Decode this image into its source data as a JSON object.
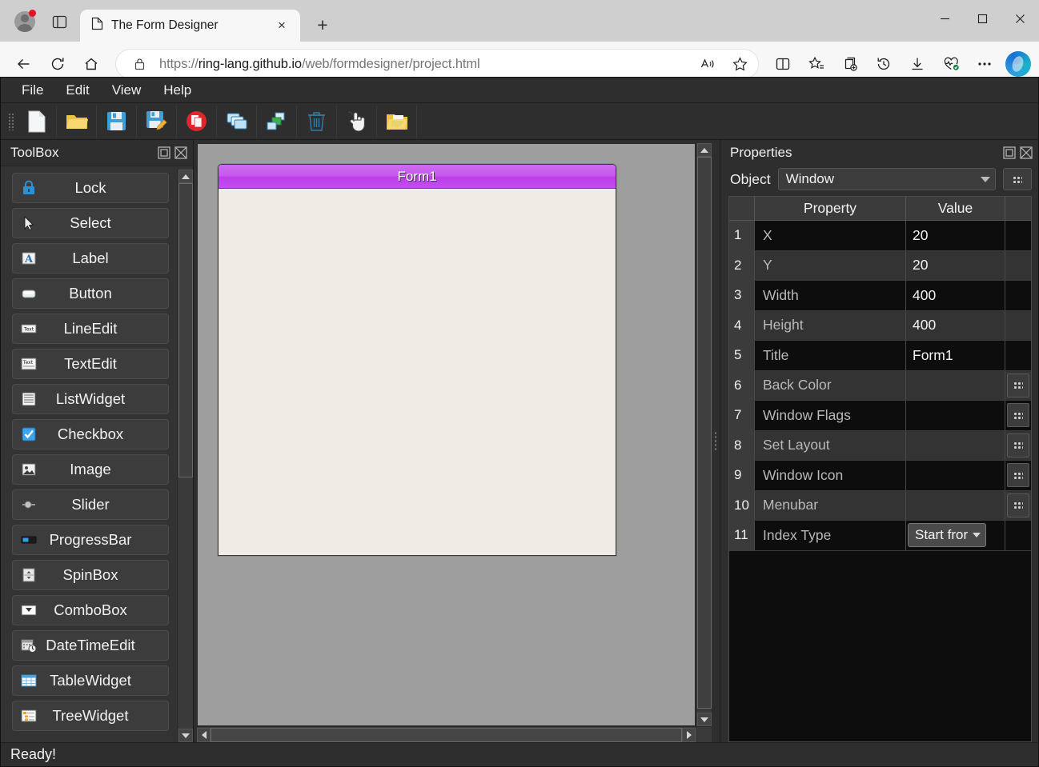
{
  "browser": {
    "tab": {
      "title": "The Form Designer",
      "close_label": "×"
    },
    "newtab_label": "+",
    "url": {
      "scheme": "https://",
      "host": "ring-lang.github.io",
      "path": "/web/formdesigner/project.html"
    },
    "window_controls": {
      "minimize": "–",
      "maximize": "□",
      "close": "×"
    },
    "icons": [
      "profile-icon",
      "split-screen-icon",
      "page-icon",
      "close-icon",
      "new-tab-icon",
      "back-icon",
      "refresh-icon",
      "home-icon",
      "lock-icon",
      "read-aloud-icon",
      "favorite-star-icon",
      "split-screen-icon",
      "favorites-icon",
      "collections-icon",
      "history-icon",
      "downloads-icon",
      "browser-essentials-icon",
      "settings-more-icon",
      "copilot-icon"
    ]
  },
  "app": {
    "menubar": [
      "File",
      "Edit",
      "View",
      "Help"
    ],
    "toolbar": [
      {
        "name": "new-file-icon"
      },
      {
        "name": "open-folder-icon"
      },
      {
        "name": "save-icon"
      },
      {
        "name": "save-as-icon"
      },
      {
        "name": "close-file-icon"
      },
      {
        "name": "copy-icon"
      },
      {
        "name": "paste-icon"
      },
      {
        "name": "delete-icon"
      },
      {
        "name": "pointer-icon"
      },
      {
        "name": "open-project-icon"
      }
    ],
    "toolbox": {
      "title": "ToolBox",
      "items": [
        {
          "label": "Lock",
          "icon": "lock-icon"
        },
        {
          "label": "Select",
          "icon": "cursor-arrow-icon"
        },
        {
          "label": "Label",
          "icon": "label-icon"
        },
        {
          "label": "Button",
          "icon": "button-icon"
        },
        {
          "label": "LineEdit",
          "icon": "lineedit-icon"
        },
        {
          "label": "TextEdit",
          "icon": "textedit-icon"
        },
        {
          "label": "ListWidget",
          "icon": "listwidget-icon"
        },
        {
          "label": "Checkbox",
          "icon": "checkbox-icon"
        },
        {
          "label": "Image",
          "icon": "image-icon"
        },
        {
          "label": "Slider",
          "icon": "slider-icon"
        },
        {
          "label": "ProgressBar",
          "icon": "progressbar-icon"
        },
        {
          "label": "SpinBox",
          "icon": "spinbox-icon"
        },
        {
          "label": "ComboBox",
          "icon": "combobox-icon"
        },
        {
          "label": "DateTimeEdit",
          "icon": "datetime-icon"
        },
        {
          "label": "TableWidget",
          "icon": "tablewidget-icon"
        },
        {
          "label": "TreeWidget",
          "icon": "treewidget-icon"
        }
      ]
    },
    "canvas": {
      "form": {
        "title": "Form1"
      }
    },
    "properties": {
      "title": "Properties",
      "object_label": "Object",
      "object_value": "Window",
      "columns": {
        "property": "Property",
        "value": "Value"
      },
      "rows": [
        {
          "n": "1",
          "property": "X",
          "value": "20",
          "editor": "none"
        },
        {
          "n": "2",
          "property": "Y",
          "value": "20",
          "editor": "none"
        },
        {
          "n": "3",
          "property": "Width",
          "value": "400",
          "editor": "none"
        },
        {
          "n": "4",
          "property": "Height",
          "value": "400",
          "editor": "none"
        },
        {
          "n": "5",
          "property": "Title",
          "value": "Form1",
          "editor": "none"
        },
        {
          "n": "6",
          "property": "Back Color",
          "value": "",
          "editor": "dots"
        },
        {
          "n": "7",
          "property": "Window Flags",
          "value": "",
          "editor": "dots"
        },
        {
          "n": "8",
          "property": "Set Layout",
          "value": "",
          "editor": "dots"
        },
        {
          "n": "9",
          "property": "Window Icon",
          "value": "",
          "editor": "dots"
        },
        {
          "n": "10",
          "property": "Menubar",
          "value": "",
          "editor": "dots"
        },
        {
          "n": "11",
          "property": "Index Type",
          "value": "Start fror",
          "editor": "combo"
        }
      ]
    },
    "statusbar": {
      "text": "Ready!"
    },
    "colors": {
      "app_bg": "#2e2e2e",
      "panel_bg": "#333333",
      "canvas_bg": "#9e9e9e",
      "form_titlebar": "#c34df0",
      "form_body": "#efece6",
      "row_dark": "#0d0d0d",
      "row_alt": "#333333"
    }
  }
}
